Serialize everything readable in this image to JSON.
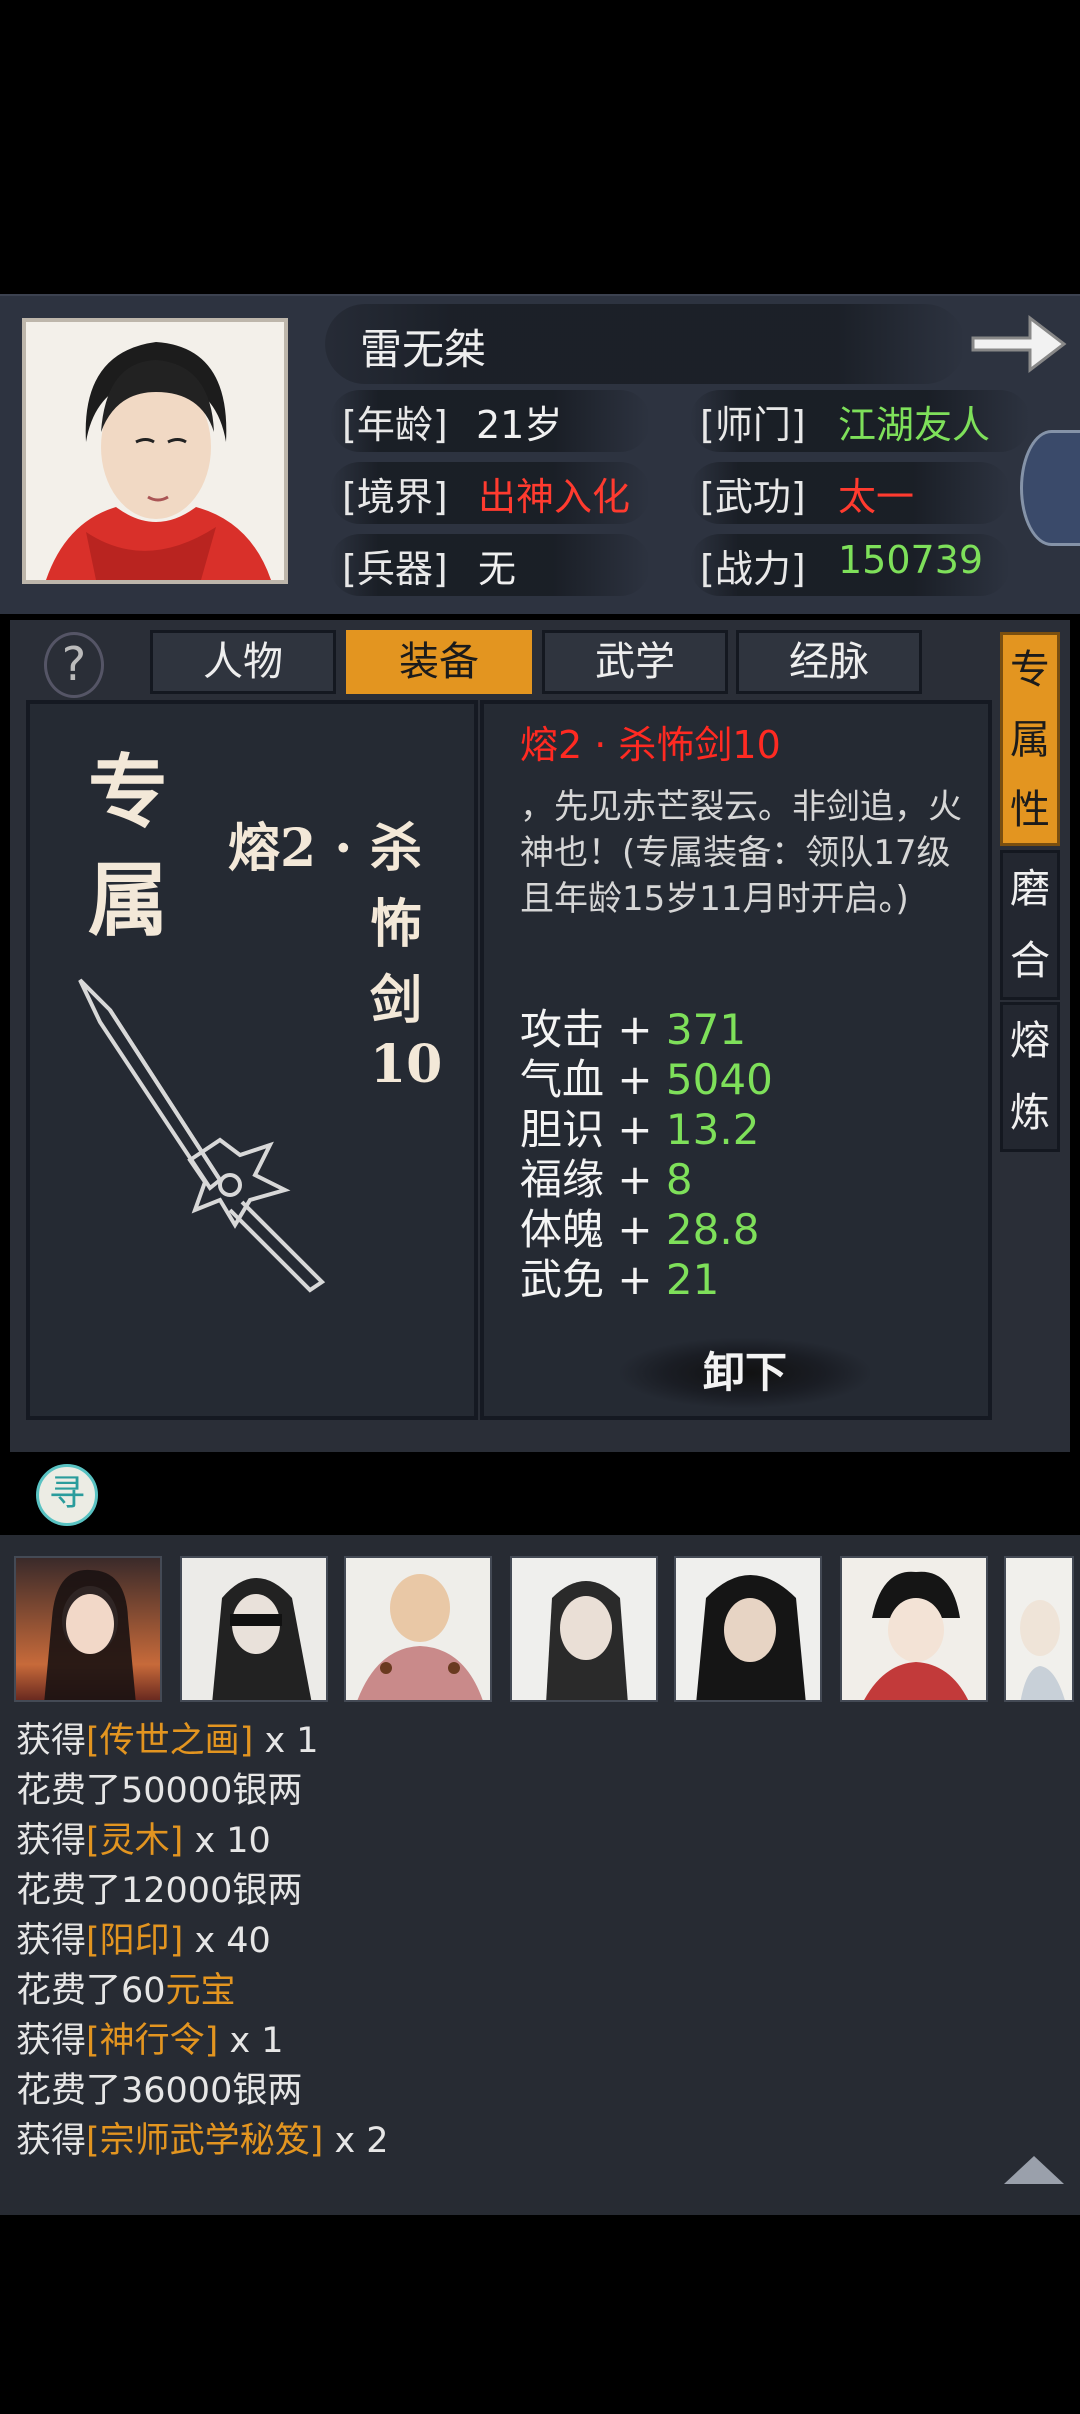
{
  "hero": {
    "name": "雷无桀",
    "age_label": "[年龄]",
    "age_value": "21岁",
    "sect_label": "[师门]",
    "sect_value": "江湖友人",
    "realm_label": "[境界]",
    "realm_value": "出神入化",
    "martial_label": "[武功]",
    "martial_value": "太一",
    "weapon_label": "[兵器]",
    "weapon_value": "无",
    "power_label": "[战力]",
    "power_value": "150739"
  },
  "tabs": [
    {
      "label": "人物",
      "active": false
    },
    {
      "label": "装备",
      "active": true
    },
    {
      "label": "武学",
      "active": false
    },
    {
      "label": "经脉",
      "active": false
    }
  ],
  "help_label": "?",
  "equipment": {
    "type_chars": [
      "专",
      "属"
    ],
    "vertical_name_prefix": "熔2 ·",
    "vertical_name_chars": [
      "杀",
      "怖",
      "剑",
      "10"
    ],
    "title": "熔2 · 杀怖剑10",
    "description": "，先见赤芒裂云。非剑追，火神也！(专属装备：领队17级且年龄15岁11月时开启。)",
    "stats": [
      {
        "name": "攻击",
        "value": "371"
      },
      {
        "name": "气血",
        "value": "5040"
      },
      {
        "name": "胆识",
        "value": "13.2"
      },
      {
        "name": "福缘",
        "value": "8"
      },
      {
        "name": "体魄",
        "value": "28.8"
      },
      {
        "name": "武免",
        "value": "21"
      }
    ],
    "unequip_label": "卸下"
  },
  "side_tabs": [
    {
      "chars": [
        "专",
        "属",
        "性"
      ],
      "active": true
    },
    {
      "chars": [
        "磨",
        "合"
      ],
      "active": false
    },
    {
      "chars": [
        "熔",
        "炼"
      ],
      "active": false
    }
  ],
  "seek_label": "寻",
  "log": [
    {
      "prefix": "获得",
      "item": "[传世之画]",
      "suffix": " x 1"
    },
    {
      "prefix": "花费了50000银两",
      "item": "",
      "suffix": ""
    },
    {
      "prefix": "获得",
      "item": "[灵木]",
      "suffix": " x 10"
    },
    {
      "prefix": "花费了12000银两",
      "item": "",
      "suffix": ""
    },
    {
      "prefix": "获得",
      "item": "[阳印]",
      "suffix": " x 40"
    },
    {
      "prefix": "花费了60",
      "item": "元宝",
      "suffix": ""
    },
    {
      "prefix": "获得",
      "item": "[神行令]",
      "suffix": " x 1"
    },
    {
      "prefix": "花费了36000银两",
      "item": "",
      "suffix": ""
    },
    {
      "prefix": "获得",
      "item": "[宗师武学秘笈]",
      "suffix": " x 2"
    }
  ],
  "colors": {
    "accent": "#e39520",
    "green": "#7ee05a",
    "red": "#ff3b2f"
  }
}
